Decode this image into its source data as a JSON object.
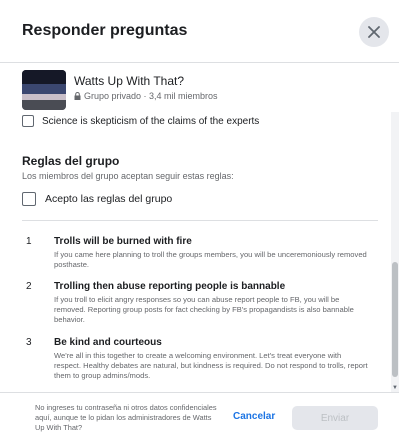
{
  "dialog": {
    "title": "Responder preguntas"
  },
  "group": {
    "name": "Watts Up With That?",
    "meta": "Grupo privado · 3,4 mil miembros"
  },
  "questions": {
    "science_option": "Science is skepticism of the claims of the experts"
  },
  "rules": {
    "title": "Reglas del grupo",
    "subtitle": "Los miembros del grupo aceptan seguir estas reglas:",
    "accept_label": "Acepto las reglas del grupo",
    "items": [
      {
        "num": "1",
        "title": "Trolls will be burned with fire",
        "desc": "If you came here planning to troll the groups members, you will be unceremoniously removed posthaste."
      },
      {
        "num": "2",
        "title": "Trolling then abuse reporting people is bannable",
        "desc": "If you troll to elicit angry responses so you can abuse report people to FB, you will be removed. Reporting group posts for fact checking by FB's propagandists is also bannable behavior."
      },
      {
        "num": "3",
        "title": "Be kind and courteous",
        "desc": "We're all in this together to create a welcoming environment. Let's treat everyone with respect. Healthy debates are natural, but kindness is required. Do not respond to trolls, report them to group admins/mods."
      }
    ]
  },
  "footer": {
    "notice": "No ingreses tu contraseña ni otros datos confidenciales aquí, aunque te lo pidan los administradores de Watts Up With That?",
    "cancel_label": "Cancelar",
    "send_label": "Enviar"
  },
  "colors": {
    "link": "#1b74e4",
    "disabled_button": "#e4e6eb"
  }
}
